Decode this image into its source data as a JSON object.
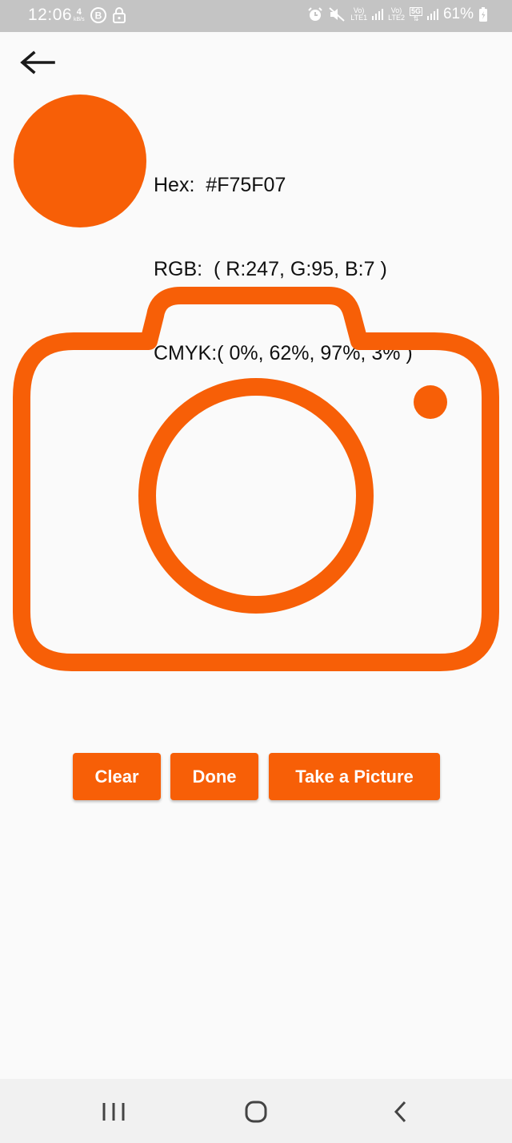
{
  "status_bar": {
    "time": "12:06",
    "net_speed_value": "4",
    "net_speed_unit": "kB/s",
    "sim1_label_top": "Vo)",
    "sim1_label_bottom": "LTE1",
    "sim2_label_top": "Vo)",
    "sim2_label_bottom": "LTE2",
    "network_type": "5G",
    "battery": "61%",
    "icons": [
      "b-circle-icon",
      "lock-icon",
      "alarm-icon",
      "mute-icon",
      "signal-icon",
      "battery-icon"
    ]
  },
  "header": {
    "back_icon": "arrow-left-icon"
  },
  "color": {
    "hex_label": "Hex:  #F75F07",
    "rgb_label": "RGB:  ( R:247, G:95, B:7 )",
    "cmyk_label": "CMYK:( 0%, 62%, 97%, 3% )",
    "swatch_color": "#F75F07"
  },
  "camera": {
    "icon": "camera-icon",
    "color": "#F75F07"
  },
  "buttons": {
    "clear": "Clear",
    "done": "Done",
    "take_picture": "Take a Picture",
    "color": "#F75F07"
  },
  "nav_bar": {
    "recents_icon": "recents-icon",
    "home_icon": "home-icon",
    "back_icon": "back-chevron-icon"
  }
}
